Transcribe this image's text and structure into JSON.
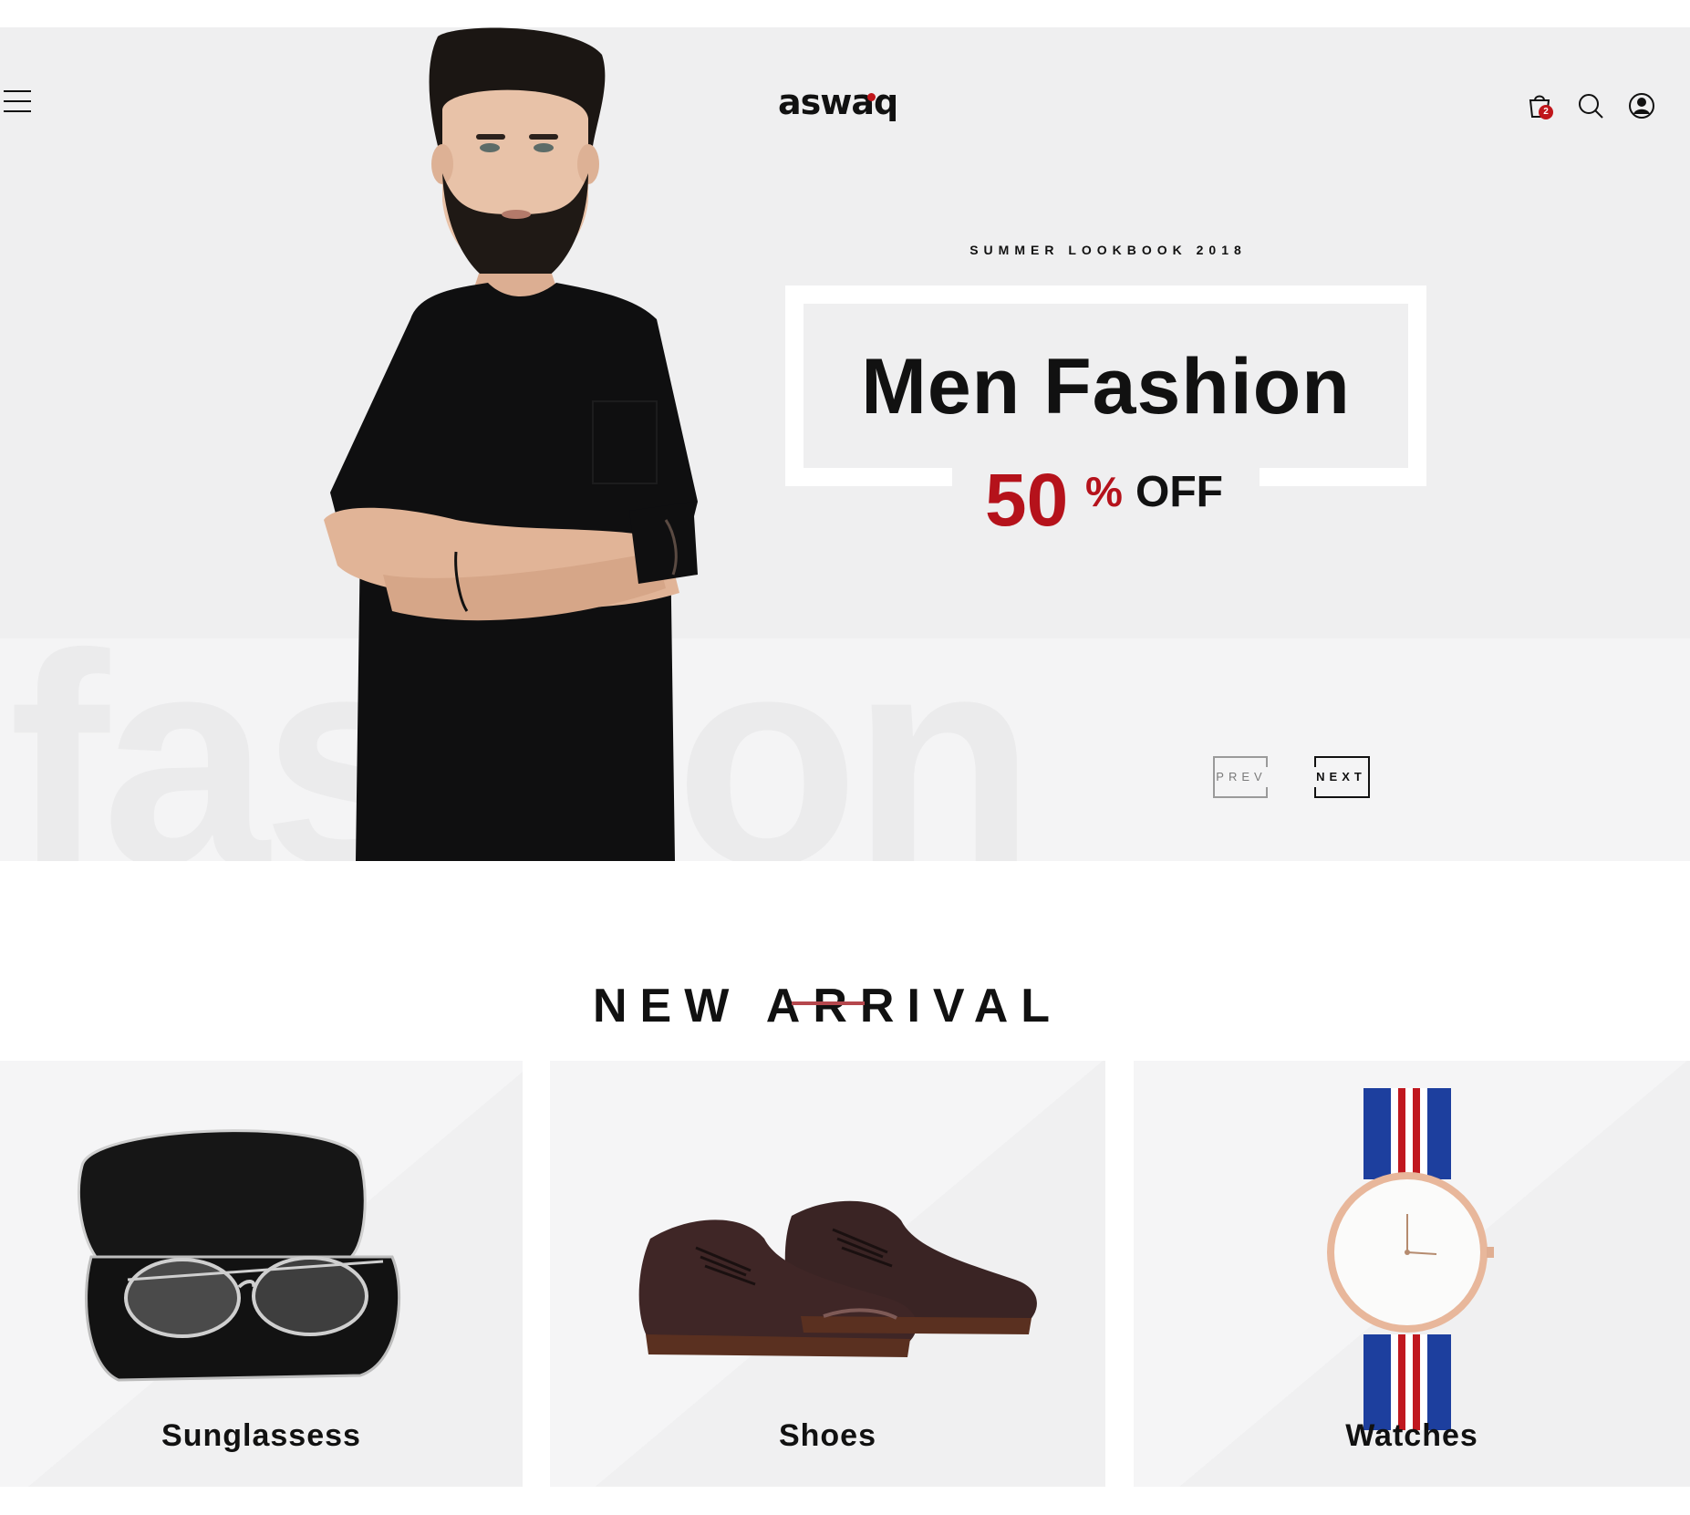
{
  "header": {
    "logo_text": "aswaq",
    "cart_count": "2",
    "icons": [
      "menu-icon",
      "cart-icon",
      "search-icon",
      "user-icon"
    ]
  },
  "hero": {
    "kicker": "SUMMER LOOKBOOK 2018",
    "headline": "Men Fashion",
    "discount_value": "50",
    "discount_percent": "%",
    "discount_suffix": "OFF",
    "watermark": "fashion",
    "prev_label": "PREV",
    "next_label": "NEXT"
  },
  "new_arrival": {
    "title": "NEW ARRIVAL",
    "items": [
      {
        "label": "Sunglassess",
        "icon": "sunglasses-image"
      },
      {
        "label": "Shoes",
        "icon": "shoes-image"
      },
      {
        "label": "Watches",
        "icon": "watch-image"
      }
    ]
  },
  "colors": {
    "accent": "#c0161b",
    "discount": "#b5121b",
    "underline": "#b5474d",
    "hero_bg": "#efeff0"
  }
}
